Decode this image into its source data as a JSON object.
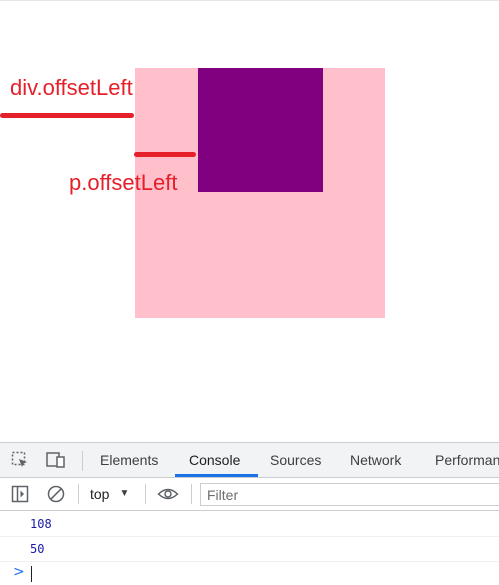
{
  "page": {
    "colors": {
      "outer_box": "#ffc0cb",
      "inner_box": "#800080",
      "annotation": "#e5202a"
    },
    "annotations": {
      "div_label": "div.offsetLeft",
      "p_label": "p.offsetLeft"
    }
  },
  "devtools": {
    "tabs": [
      {
        "label": "Elements"
      },
      {
        "label": "Console",
        "active": true
      },
      {
        "label": "Sources"
      },
      {
        "label": "Network"
      },
      {
        "label": "Performan"
      }
    ],
    "toolbar": {
      "context": "top",
      "filter_placeholder": "Filter"
    },
    "console": {
      "messages": [
        "108",
        "50"
      ],
      "prompt": ">"
    },
    "icons": {
      "inspect": "inspect-element-icon",
      "device": "device-toolbar-icon",
      "sidebar": "show-sidebar-icon",
      "clear": "clear-console-icon",
      "eye": "live-expression-icon"
    }
  }
}
